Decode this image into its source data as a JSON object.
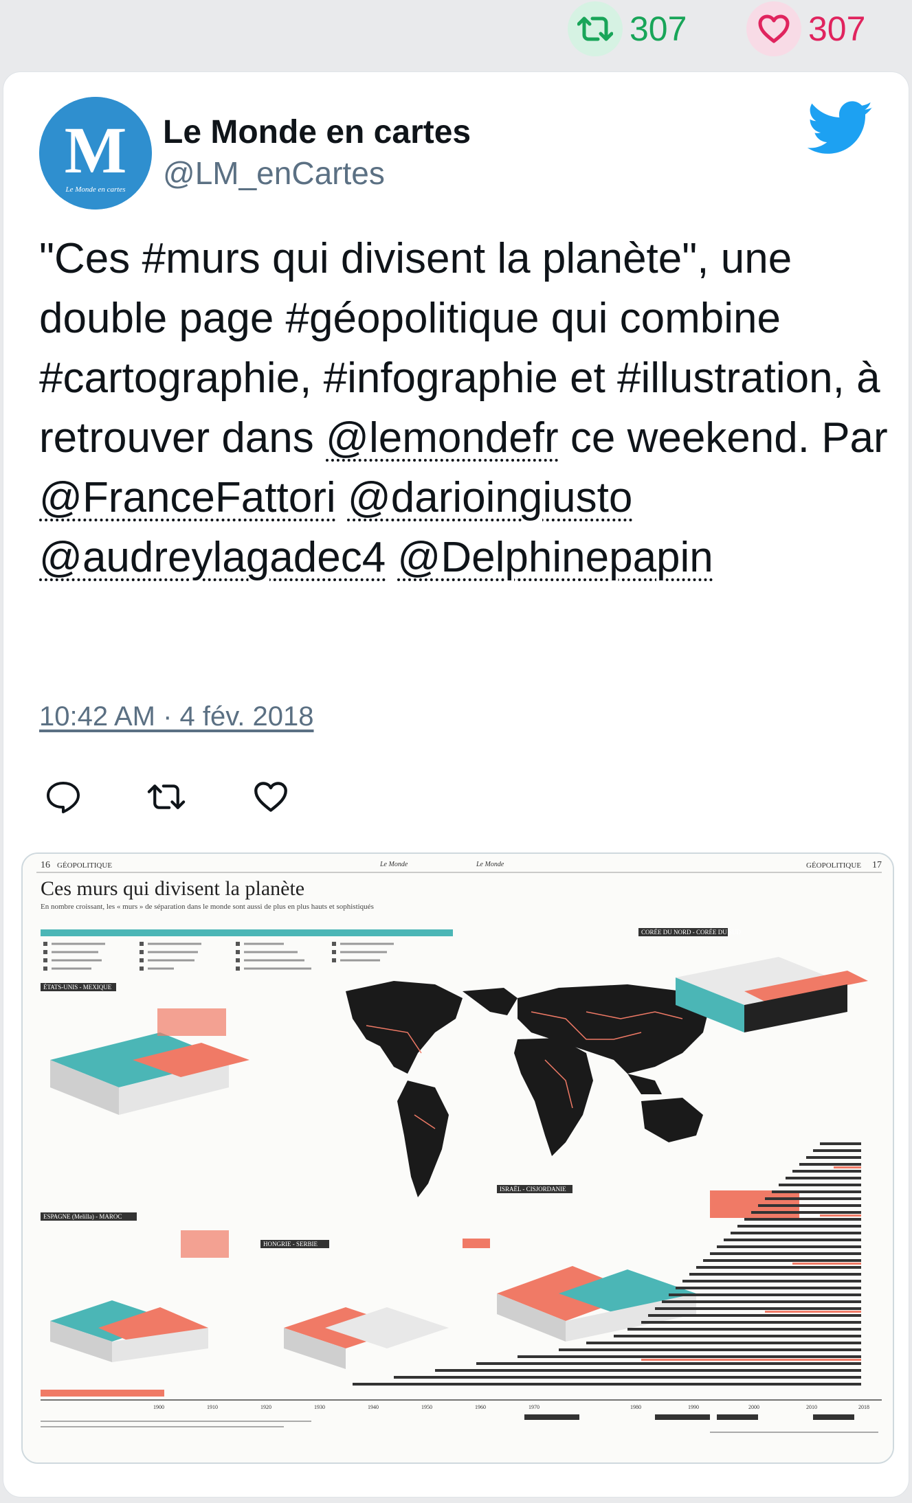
{
  "stats": {
    "retweets": "307",
    "likes": "307"
  },
  "author": {
    "name": "Le Monde en cartes",
    "handle": "@LM_enCartes",
    "avatar_letter": "M",
    "avatar_caption": "Le Monde en cartes"
  },
  "tweet": {
    "part1": "\"Ces #murs qui divisent la planète\", une double page #géopolitique qui combine #cartographie, #infographie et #illustration, à retrouver dans ",
    "mention1": "@lemondefr",
    "part2": " ce weekend. Par ",
    "mention2": "@FranceFattori",
    "mention3": "@darioingiusto",
    "mention4": "@audreylagadec4",
    "mention5": "@Delphinepapin",
    "timestamp": "10:42 AM · 4 fév. 2018"
  },
  "icons": {
    "retweet": "retweet-icon",
    "like": "heart-icon",
    "reply": "reply-icon",
    "twitter": "twitter-bird-icon"
  },
  "colors": {
    "retweet_green": "#19a559",
    "like_pink": "#e0245e",
    "twitter_blue": "#1da1f2",
    "map_teal": "#4bb6b6",
    "map_salmon": "#f07a66"
  },
  "media": {
    "page_left": "16",
    "section_left": "GÉOPOLITIQUE",
    "page_right": "17",
    "section_right": "GÉOPOLITIQUE",
    "masthead_left": "Le Monde",
    "masthead_right": "Le Monde",
    "title": "Ces murs qui divisent la planète",
    "subtitle": "En nombre croissant, les « murs » de séparation dans le monde sont aussi de plus en plus hauts et sophistiqués",
    "sections": [
      "ÉTATS-UNIS - MEXIQUE",
      "CORÉE DU NORD - CORÉE DU SUD",
      "ESPAGNE (Melilla) - MAROC",
      "HONGRIE - SERBIE",
      "ISRAËL - CISJORDANIE"
    ],
    "years": [
      "1900",
      "1910",
      "1920",
      "1930",
      "1940",
      "1950",
      "1960",
      "1970",
      "1980",
      "1990",
      "2000",
      "2010",
      "2018"
    ]
  }
}
